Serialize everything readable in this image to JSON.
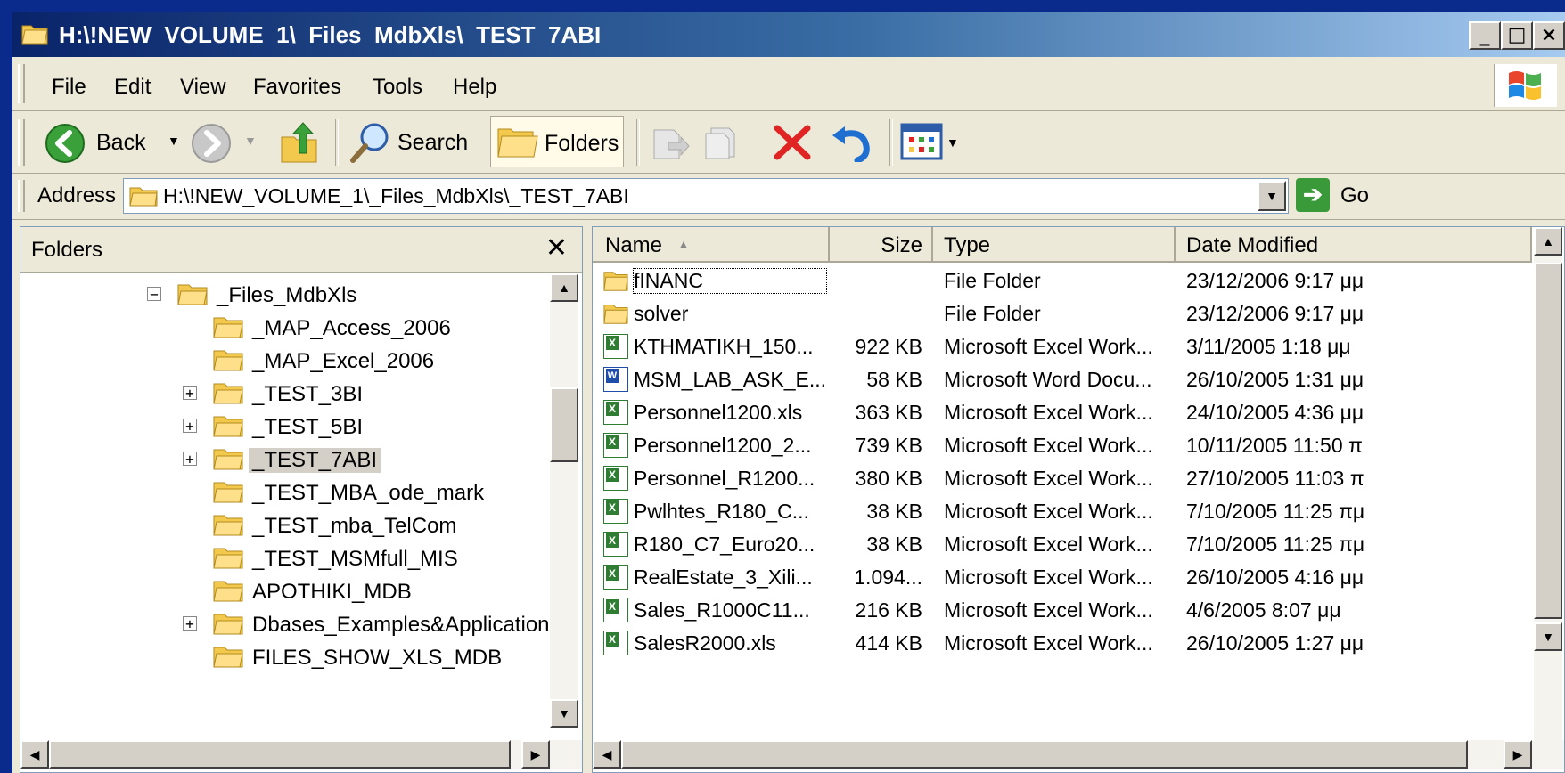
{
  "window": {
    "title": "H:\\!NEW_VOLUME_1\\_Files_MdbXls\\_TEST_7ABI"
  },
  "menu": [
    "File",
    "Edit",
    "View",
    "Favorites",
    "Tools",
    "Help"
  ],
  "toolbar": {
    "back": "Back",
    "search": "Search",
    "folders": "Folders"
  },
  "address": {
    "label": "Address",
    "value": "H:\\!NEW_VOLUME_1\\_Files_MdbXls\\_TEST_7ABI",
    "go": "Go"
  },
  "folders_pane": {
    "title": "Folders",
    "tree": [
      {
        "label": "_Files_MdbXls",
        "expander": "−"
      },
      {
        "label": "_MAP_Access_2006",
        "expander": ""
      },
      {
        "label": "_MAP_Excel_2006",
        "expander": ""
      },
      {
        "label": "_TEST_3BI",
        "expander": "+"
      },
      {
        "label": "_TEST_5BI",
        "expander": "+"
      },
      {
        "label": "_TEST_7ABI",
        "expander": "+",
        "selected": true
      },
      {
        "label": "_TEST_MBA_ode_mark",
        "expander": ""
      },
      {
        "label": "_TEST_mba_TelCom",
        "expander": ""
      },
      {
        "label": "_TEST_MSMfull_MIS",
        "expander": ""
      },
      {
        "label": "APOTHIKI_MDB",
        "expander": ""
      },
      {
        "label": "Dbases_Examples&Applications",
        "expander": "+"
      },
      {
        "label": "FILES_SHOW_XLS_MDB",
        "expander": ""
      }
    ]
  },
  "file_list": {
    "columns": {
      "name": "Name",
      "size": "Size",
      "type": "Type",
      "date": "Date Modified"
    },
    "rows": [
      {
        "icon": "folder",
        "name": "fINANC",
        "size": "",
        "type": "File Folder",
        "date": "23/12/2006 9:17 μμ"
      },
      {
        "icon": "folder",
        "name": "solver",
        "size": "",
        "type": "File Folder",
        "date": "23/12/2006 9:17 μμ"
      },
      {
        "icon": "excel",
        "name": "KTHMATIKH_150...",
        "size": "922 KB",
        "type": "Microsoft Excel Work...",
        "date": "3/11/2005 1:18 μμ"
      },
      {
        "icon": "word",
        "name": "MSM_LAB_ASK_E...",
        "size": "58 KB",
        "type": "Microsoft Word Docu...",
        "date": "26/10/2005 1:31 μμ"
      },
      {
        "icon": "excel",
        "name": "Personnel1200.xls",
        "size": "363 KB",
        "type": "Microsoft Excel Work...",
        "date": "24/10/2005 4:36 μμ"
      },
      {
        "icon": "excel",
        "name": "Personnel1200_2...",
        "size": "739 KB",
        "type": "Microsoft Excel Work...",
        "date": "10/11/2005 11:50 π"
      },
      {
        "icon": "excel",
        "name": "Personnel_R1200...",
        "size": "380 KB",
        "type": "Microsoft Excel Work...",
        "date": "27/10/2005 11:03 π"
      },
      {
        "icon": "excel",
        "name": "Pwlhtes_R180_C...",
        "size": "38 KB",
        "type": "Microsoft Excel Work...",
        "date": "7/10/2005 11:25 πμ"
      },
      {
        "icon": "excel",
        "name": "R180_C7_Euro20...",
        "size": "38 KB",
        "type": "Microsoft Excel Work...",
        "date": "7/10/2005 11:25 πμ"
      },
      {
        "icon": "excel",
        "name": "RealEstate_3_Xili...",
        "size": "1.094...",
        "type": "Microsoft Excel Work...",
        "date": "26/10/2005 4:16 μμ"
      },
      {
        "icon": "excel",
        "name": "Sales_R1000C11...",
        "size": "216 KB",
        "type": "Microsoft Excel Work...",
        "date": "4/6/2005 8:07 μμ"
      },
      {
        "icon": "excel",
        "name": "SalesR2000.xls",
        "size": "414 KB",
        "type": "Microsoft Excel Work...",
        "date": "26/10/2005 1:27 μμ"
      }
    ]
  }
}
